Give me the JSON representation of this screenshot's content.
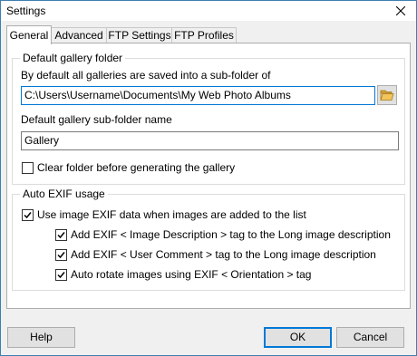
{
  "window": {
    "title": "Settings"
  },
  "tabs": [
    {
      "label": "General"
    },
    {
      "label": "Advanced"
    },
    {
      "label": "FTP Settings"
    },
    {
      "label": "FTP Profiles"
    }
  ],
  "default_folder_group": {
    "title": "Default gallery folder",
    "path_label": "By default all galleries are saved into a sub-folder of",
    "path_value": "C:\\Users\\Username\\Documents\\My Web Photo Albums",
    "subfolder_label": "Default gallery sub-folder name",
    "subfolder_value": "Gallery",
    "clear_folder_label": "Clear folder before generating the gallery",
    "clear_folder_checked": false
  },
  "exif_group": {
    "title": "Auto EXIF usage",
    "use_exif_label": "Use image EXIF data when images are added to the list",
    "use_exif_checked": true,
    "options": [
      {
        "label": "Add EXIF < Image Description > tag to the Long image description",
        "checked": true
      },
      {
        "label": "Add EXIF < User Comment > tag to the Long image description",
        "checked": true
      },
      {
        "label": "Auto rotate images using EXIF < Orientation > tag",
        "checked": true
      }
    ]
  },
  "buttons": {
    "help": "Help",
    "ok": "OK",
    "cancel": "Cancel"
  },
  "icons": {
    "close": "close-icon",
    "folder": "folder-icon",
    "check": "checkmark-icon"
  },
  "colors": {
    "accent": "#0078d7",
    "folder": "#e8b54a"
  }
}
